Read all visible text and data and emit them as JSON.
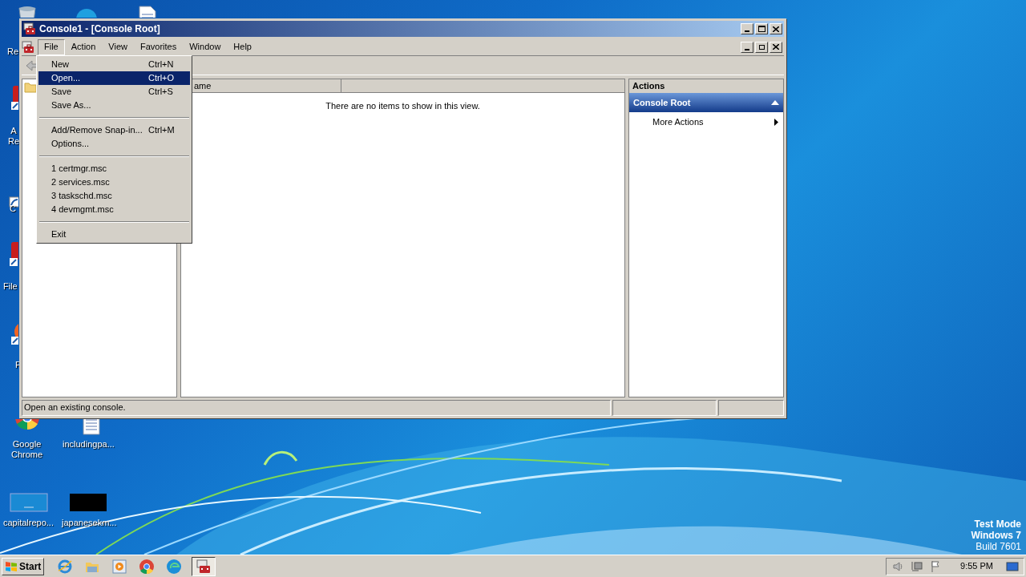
{
  "desktop": {
    "icons": [
      {
        "kind": "bin",
        "label_lines": [
          "Re"
        ]
      },
      {
        "kind": "red",
        "label_lines": [
          "A",
          "Re"
        ]
      },
      {
        "kind": "shortcut",
        "label_lines": [
          "C"
        ]
      },
      {
        "kind": "red",
        "label_lines": [
          "File"
        ]
      },
      {
        "kind": "orange",
        "label_lines": [
          "F"
        ]
      },
      {
        "kind": "round"
      },
      {
        "kind": "doc"
      },
      {
        "kind": "chrome",
        "label_lines": [
          "Google",
          "Chrome"
        ]
      },
      {
        "kind": "doc",
        "label_lines": [
          "includingpa..."
        ]
      },
      {
        "kind": "blank",
        "label_lines": [
          "capitalrepo..."
        ]
      },
      {
        "kind": "black",
        "label_lines": [
          "japanesekm..."
        ]
      }
    ],
    "os_notice": [
      "Test Mode",
      "Windows 7",
      "Build 7601"
    ]
  },
  "window": {
    "title": "Console1 - [Console Root]",
    "menu": [
      {
        "label": "File",
        "selected": true
      },
      {
        "label": "Action",
        "selected": false
      },
      {
        "label": "View",
        "selected": false
      },
      {
        "label": "Favorites",
        "selected": false
      },
      {
        "label": "Window",
        "selected": false
      },
      {
        "label": "Help",
        "selected": false
      }
    ],
    "file_menu": [
      {
        "kind": "item",
        "label": "New",
        "shortcut": "Ctrl+N",
        "selected": false
      },
      {
        "kind": "item",
        "label": "Open...",
        "shortcut": "Ctrl+O",
        "selected": true
      },
      {
        "kind": "item",
        "label": "Save",
        "shortcut": "Ctrl+S",
        "selected": false
      },
      {
        "kind": "item",
        "label": "Save As...",
        "selected": false
      },
      {
        "kind": "separator"
      },
      {
        "kind": "item",
        "label": "Add/Remove Snap-in...",
        "shortcut": "Ctrl+M",
        "selected": false
      },
      {
        "kind": "item",
        "label": "Options...",
        "selected": false
      },
      {
        "kind": "separator"
      },
      {
        "kind": "item",
        "label": "1 certmgr.msc",
        "selected": false
      },
      {
        "kind": "item",
        "label": "2 services.msc",
        "selected": false
      },
      {
        "kind": "item",
        "label": "3 taskschd.msc",
        "selected": false
      },
      {
        "kind": "item",
        "label": "4 devmgmt.msc",
        "selected": false
      },
      {
        "kind": "separator"
      },
      {
        "kind": "item",
        "label": "Exit",
        "selected": false
      }
    ],
    "list": {
      "column": "ame",
      "empty_message": "There are no items to show in this view."
    },
    "actions": {
      "header": "Actions",
      "section": "Console Root",
      "items": [
        "More Actions"
      ]
    },
    "status_bar": "Open an existing console."
  },
  "taskbar": {
    "start": "Start",
    "apps": [
      {
        "kind": "ie",
        "selected": false
      },
      {
        "kind": "folder",
        "selected": false
      },
      {
        "kind": "player",
        "selected": false
      },
      {
        "kind": "chrome",
        "selected": false
      },
      {
        "kind": "edge",
        "selected": false
      },
      {
        "kind": "mmc",
        "selected": true
      }
    ],
    "time": "9:55 PM"
  }
}
